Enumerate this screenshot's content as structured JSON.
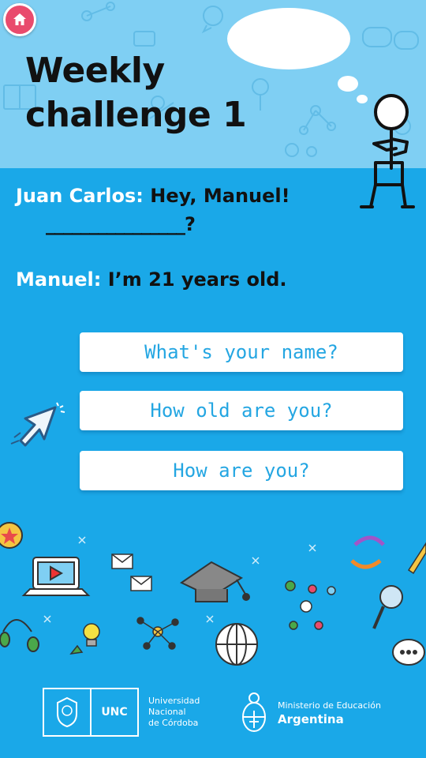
{
  "title": {
    "line1": "Weekly",
    "line2": "challenge 1"
  },
  "dialog": {
    "line1": {
      "speaker": "Juan Carlos:",
      "text": "Hey, Manuel!",
      "blank": "________________?"
    },
    "line2": {
      "speaker": "Manuel:",
      "text": "I’m 21 years old."
    }
  },
  "options": [
    {
      "label": "What's your name?"
    },
    {
      "label": "How old are you?"
    },
    {
      "label": "How are you?"
    }
  ],
  "footer": {
    "unc": {
      "acronym": "UNC",
      "name_lines": [
        "Universidad",
        "Nacional",
        "de Córdoba"
      ]
    },
    "ministry": {
      "line1": "Ministerio de Educación",
      "line2": "Argentina"
    }
  },
  "colors": {
    "background": "#1aa8e8",
    "header_background": "#7fcff3",
    "home_button": "#e94b6d",
    "option_text": "#24a6e2",
    "speaker_text": "#ffffff",
    "speech_text": "#111111"
  },
  "icons": {
    "home": "home-icon",
    "pointer": "cursor-pointer-icon"
  }
}
